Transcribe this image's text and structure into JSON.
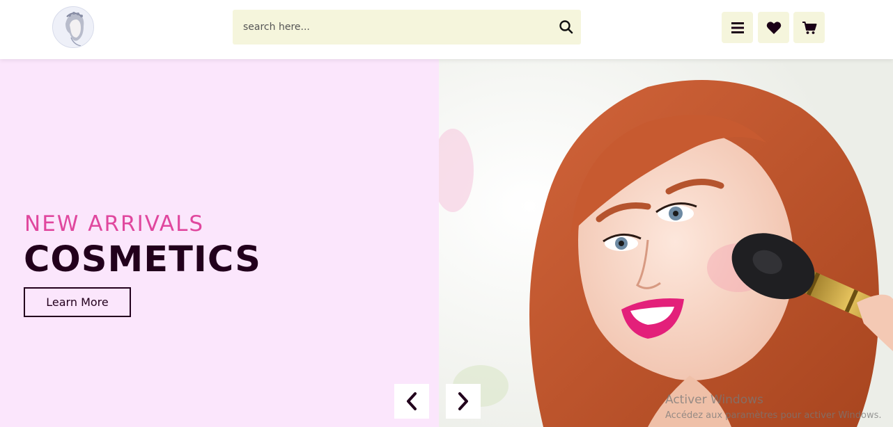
{
  "header": {
    "search": {
      "placeholder": "search here..."
    }
  },
  "hero": {
    "subtitle": "NEW ARRIVALS",
    "title": "COSMETICS",
    "button_label": "Learn More"
  },
  "watermark": {
    "title": "Activer Windows",
    "subtitle": "Accédez aux paramètres pour activer Windows."
  },
  "colors": {
    "header_button_bg": "#f5f5dc",
    "hero_bg": "#fbe6fc",
    "accent_pink": "#e0479e",
    "dark_text": "#22001c"
  },
  "icons": [
    "logo-woman",
    "search-icon",
    "menu-icon",
    "heart-icon",
    "cart-icon",
    "chevron-left-icon",
    "chevron-right-icon"
  ]
}
